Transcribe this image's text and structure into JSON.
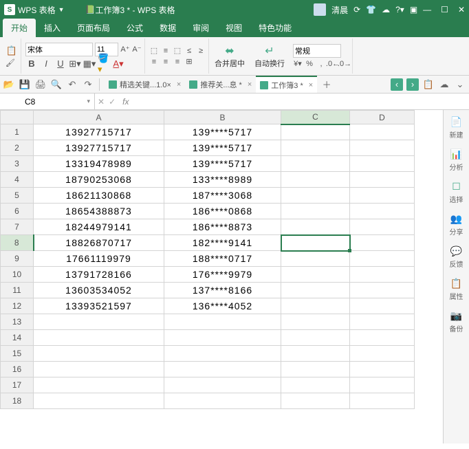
{
  "titlebar": {
    "app_name": "WPS 表格",
    "doc_title": "工作簿3 * - WPS 表格",
    "user_name": "清晨"
  },
  "menutabs": [
    "开始",
    "插入",
    "页面布局",
    "公式",
    "数据",
    "审阅",
    "视图",
    "特色功能"
  ],
  "active_tab": 0,
  "ribbon": {
    "font_name": "宋体",
    "font_size": "11",
    "number_format": "常规",
    "merge_label": "合并居中",
    "wrap_label": "自动换行"
  },
  "doc_tabs": [
    {
      "label": "精选关键...1.0×",
      "active": false
    },
    {
      "label": "推荐关...息 *",
      "active": false
    },
    {
      "label": "工作簿3 *",
      "active": true
    }
  ],
  "namebox": "C8",
  "columns": [
    "A",
    "B",
    "C",
    "D"
  ],
  "selected_col": "C",
  "selected_row": 8,
  "rows": [
    {
      "A": "13927715717",
      "B": "139****5717"
    },
    {
      "A": "13927715717",
      "B": "139****5717"
    },
    {
      "A": "13319478989",
      "B": "139****5717"
    },
    {
      "A": "18790253068",
      "B": "133****8989"
    },
    {
      "A": "18621130868",
      "B": "187****3068"
    },
    {
      "A": "18654388873",
      "B": "186****0868"
    },
    {
      "A": "18244979141",
      "B": "186****8873"
    },
    {
      "A": "18826870717",
      "B": "182****9141"
    },
    {
      "A": "17661119979",
      "B": "188****0717"
    },
    {
      "A": "13791728166",
      "B": "176****9979"
    },
    {
      "A": "13603534052",
      "B": "137****8166"
    },
    {
      "A": "13393521597",
      "B": "136****4052"
    },
    {
      "A": "",
      "B": ""
    },
    {
      "A": "",
      "B": ""
    },
    {
      "A": "",
      "B": ""
    },
    {
      "A": "",
      "B": ""
    },
    {
      "A": "",
      "B": ""
    },
    {
      "A": "",
      "B": ""
    }
  ],
  "sidepanel": [
    {
      "icon": "📄",
      "label": "新建"
    },
    {
      "icon": "📊",
      "label": "分析"
    },
    {
      "icon": "☐",
      "label": "选择"
    },
    {
      "icon": "👥",
      "label": "分享"
    },
    {
      "icon": "💬",
      "label": "反馈"
    },
    {
      "icon": "📋",
      "label": "属性"
    },
    {
      "icon": "📷",
      "label": "备份"
    }
  ]
}
